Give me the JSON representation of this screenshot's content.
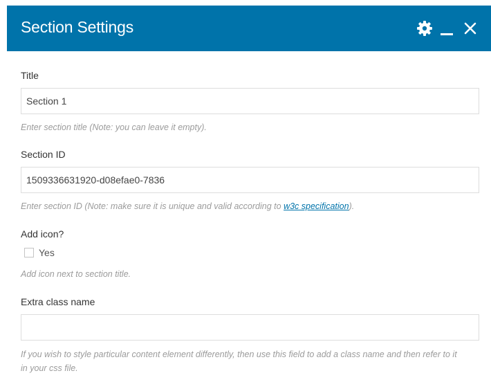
{
  "header": {
    "title": "Section Settings",
    "accent_color": "#0073aa",
    "icons": [
      "gear-icon",
      "minimize-icon",
      "close-icon"
    ]
  },
  "fields": {
    "title": {
      "label": "Title",
      "value": "Section 1",
      "help": "Enter section title (Note: you can leave it empty)."
    },
    "section_id": {
      "label": "Section ID",
      "value": "1509336631920-d08efae0-7836",
      "help_prefix": "Enter section ID (Note: make sure it is unique and valid according to ",
      "help_link": "w3c specification",
      "help_suffix": ")."
    },
    "add_icon": {
      "label": "Add icon?",
      "checkbox_label": "Yes",
      "checked": false,
      "help": "Add icon next to section title."
    },
    "extra_class": {
      "label": "Extra class name",
      "value": "",
      "help": "If you wish to style particular content element differently, then use this field to add a class name and then refer to it in your css file."
    }
  }
}
